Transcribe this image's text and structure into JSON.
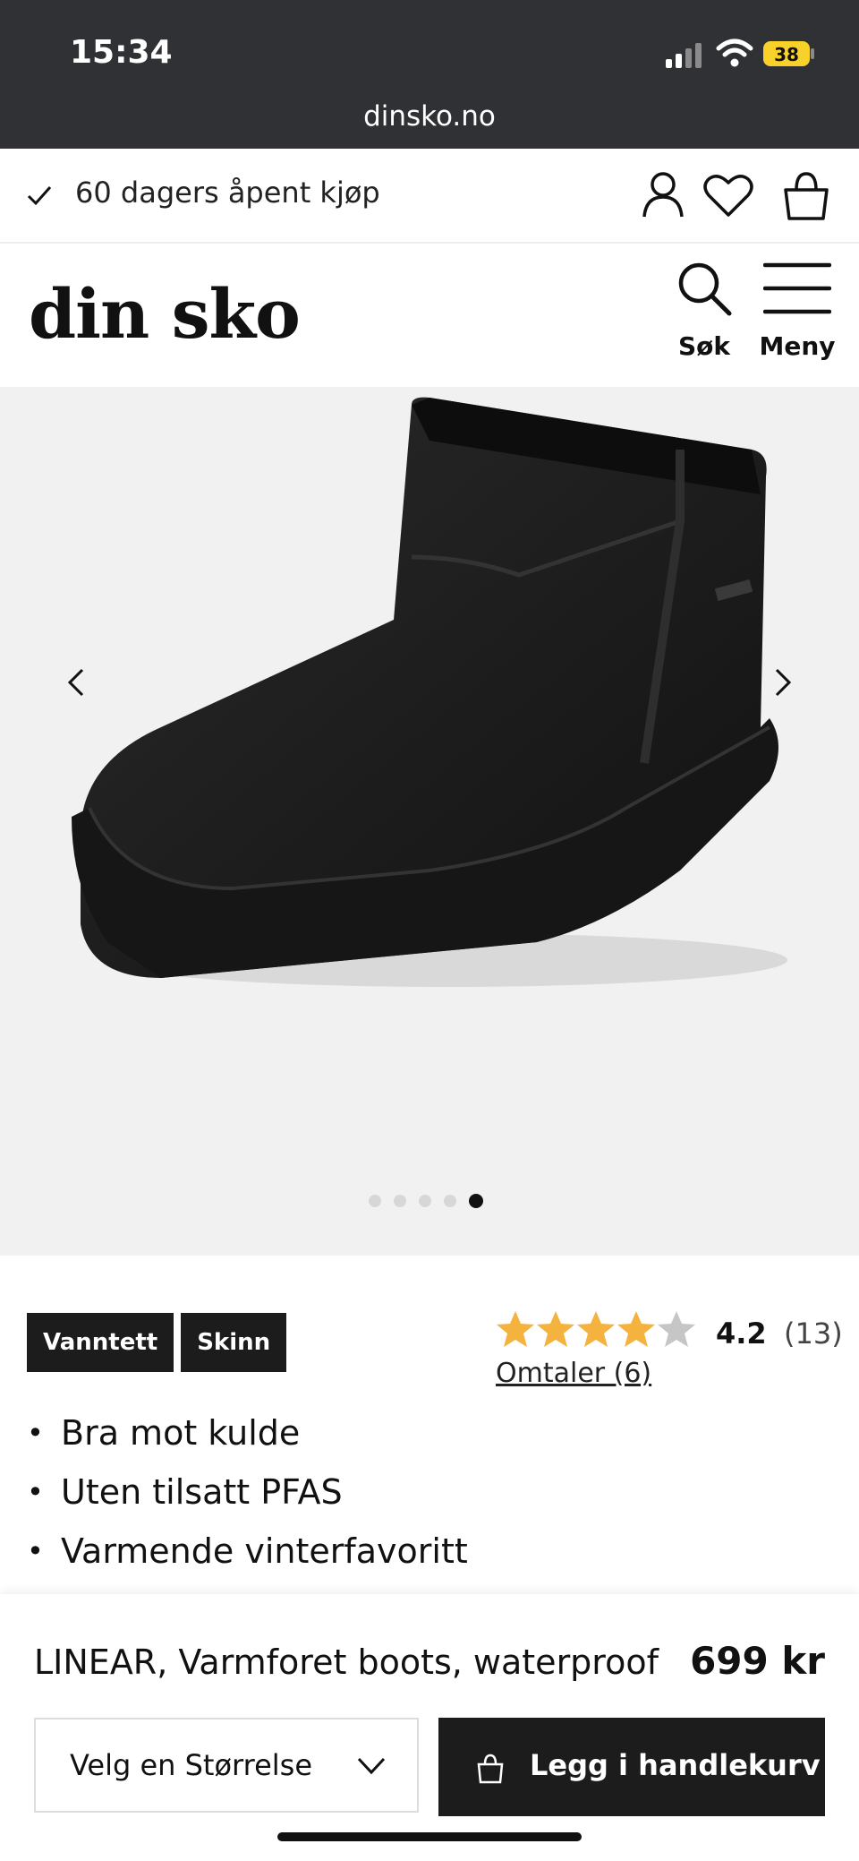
{
  "status_bar": {
    "time": "15:34",
    "battery": "38"
  },
  "browser": {
    "url": "dinsko.no"
  },
  "promo": {
    "text": "60 dagers åpent kjøp"
  },
  "header": {
    "logo": "din sko",
    "search_label": "Søk",
    "menu_label": "Meny"
  },
  "gallery": {
    "slides": 5,
    "active_slide": 5
  },
  "product": {
    "tags": [
      "Vanntett",
      "Skinn"
    ],
    "rating": {
      "score": "4.2",
      "count": "(13)",
      "stars_value": 4.2,
      "reviews_link": "Omtaler (6)"
    },
    "bullets": [
      "Bra mot kulde",
      "Uten tilsatt PFAS",
      "Varmende vinterfavoritt"
    ],
    "name": "LINEAR, Varmforet boots, waterproof",
    "price": "699 kr"
  },
  "actions": {
    "size_select": "Velg en Størrelse",
    "add_to_cart": "Legg i handlekurv"
  },
  "colors": {
    "topbar": "#2f3134",
    "gallery_bg": "#f1f1f1",
    "star": "#f4b23f",
    "button": "#1c1c1c",
    "battery": "#f8d22a"
  }
}
